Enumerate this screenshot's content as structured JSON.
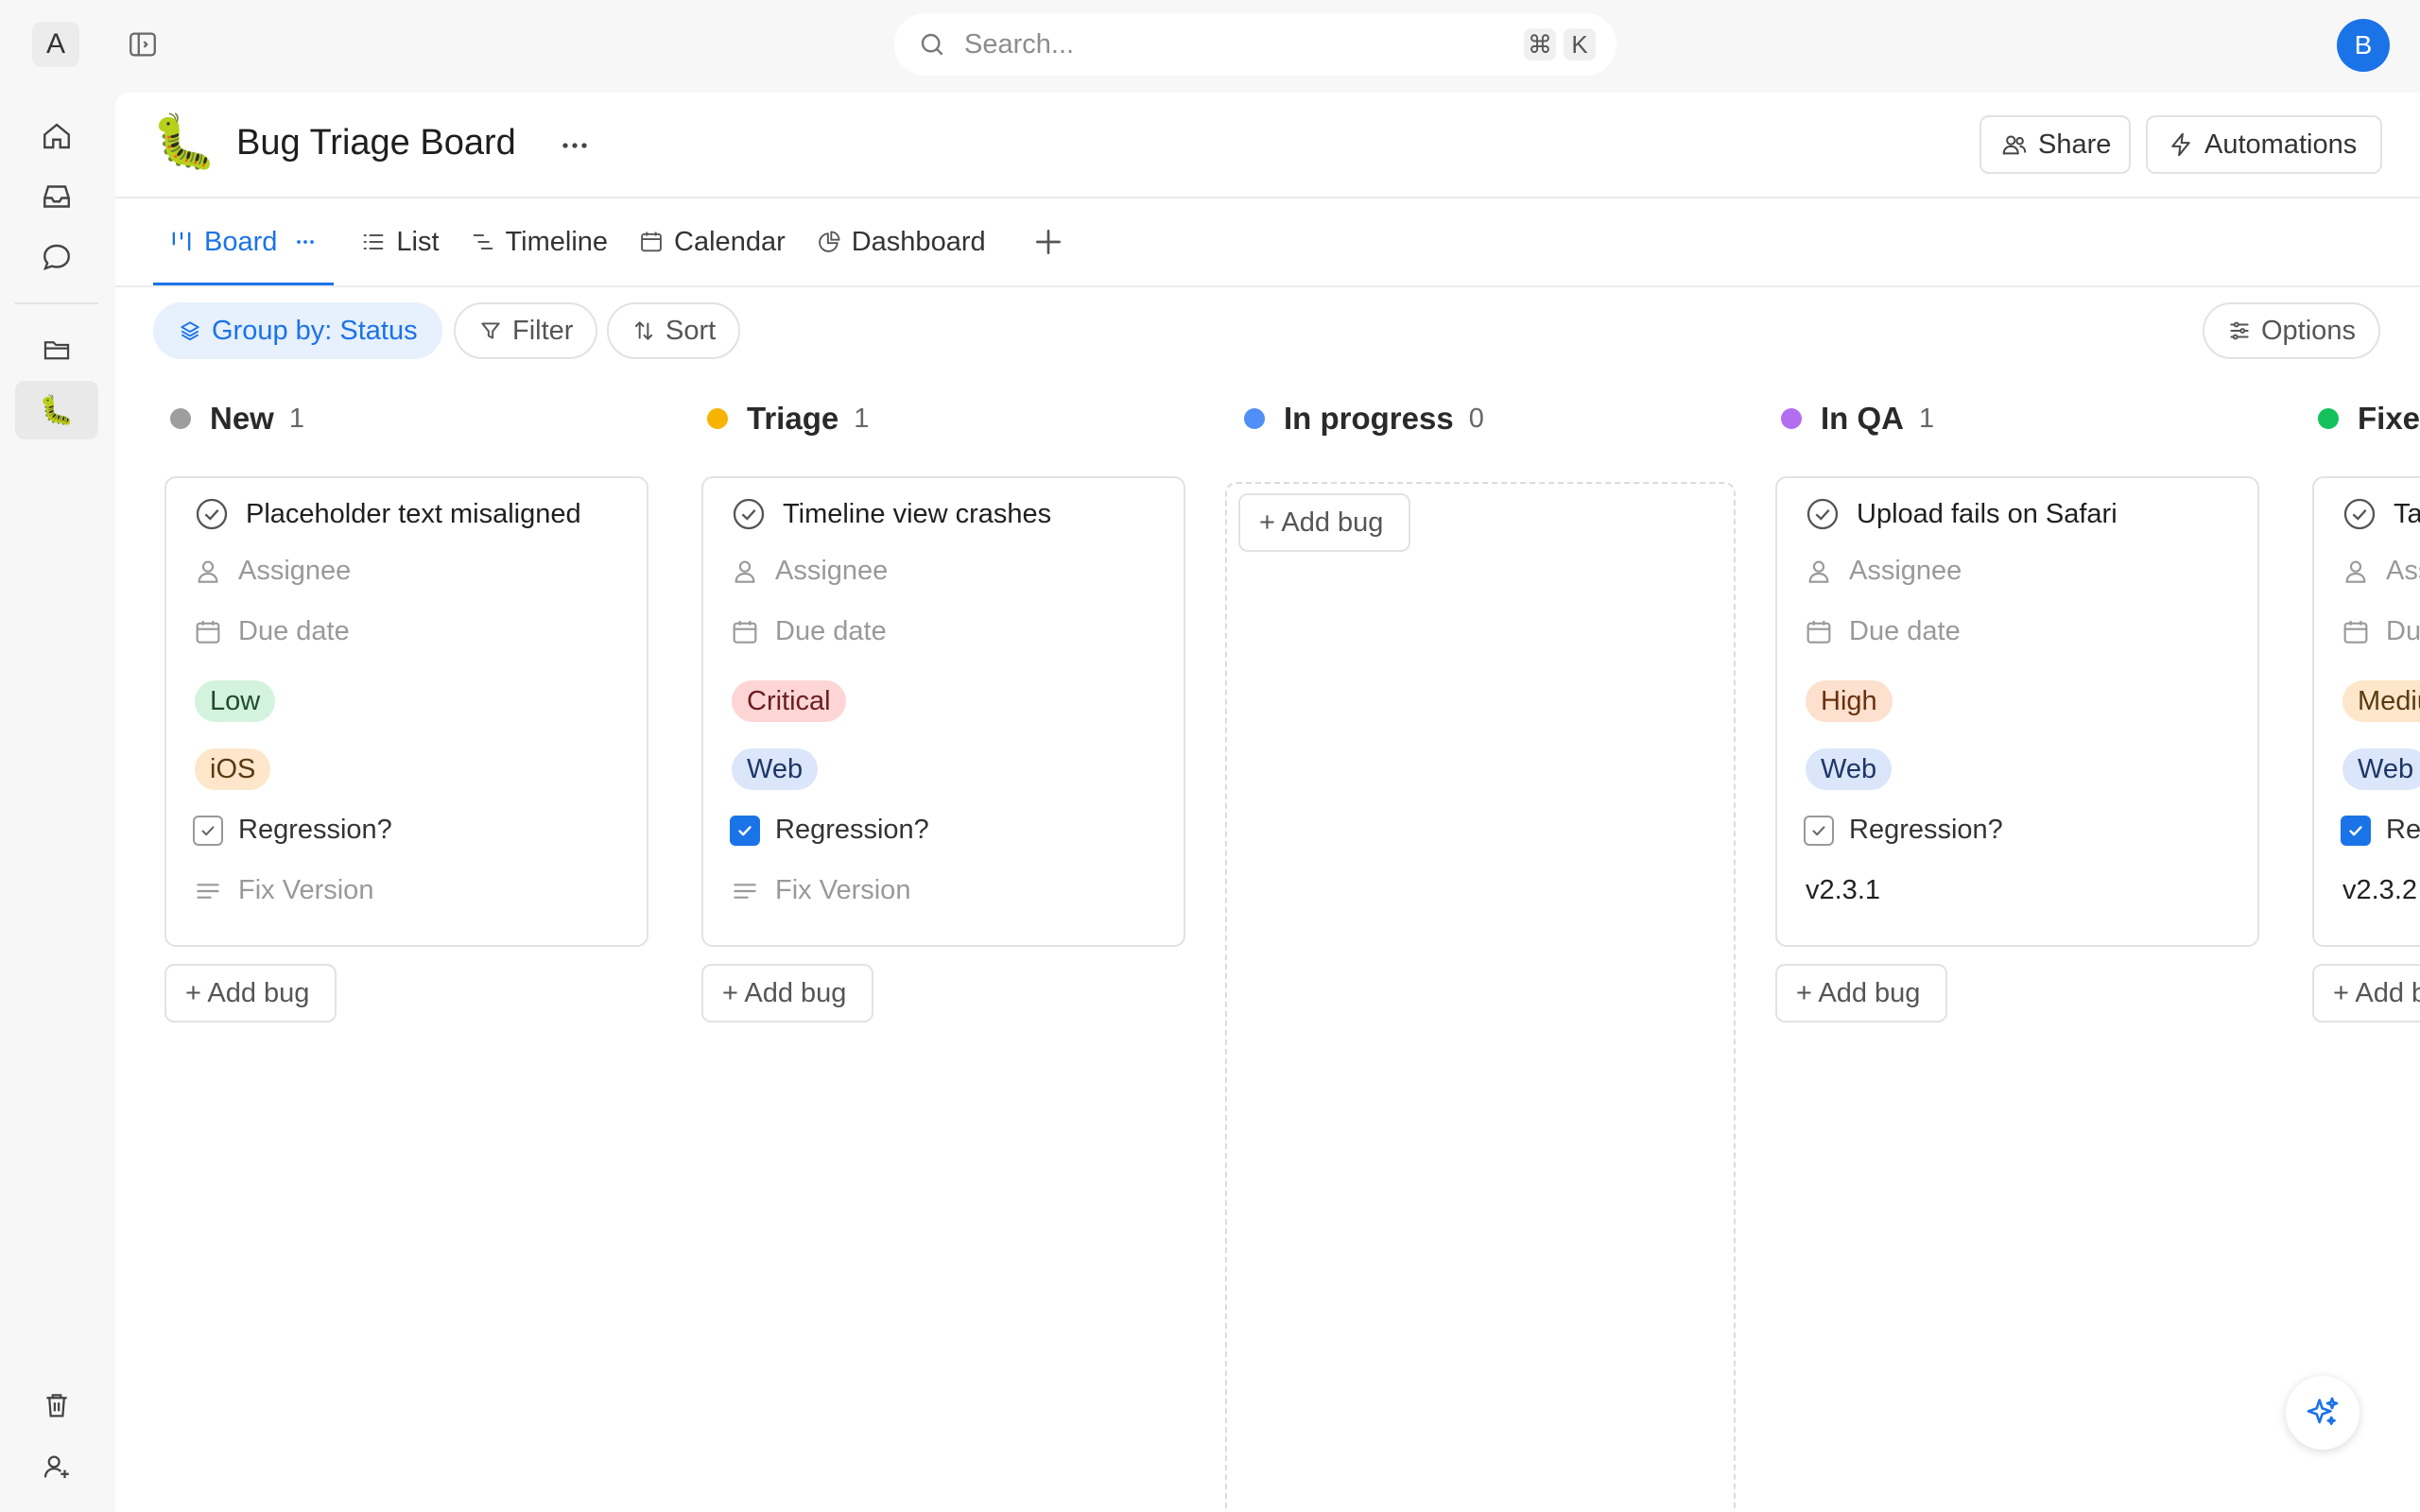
{
  "workspace": {
    "initial": "A"
  },
  "search": {
    "placeholder": "Search...",
    "shortcut_modifier": "⌘",
    "shortcut_key": "K"
  },
  "user": {
    "initial": "B"
  },
  "rail": {
    "top_icons": [
      "home-icon",
      "inbox-icon",
      "chat-icon"
    ],
    "mid_icons": [
      "folder-icon",
      "caterpillar-icon"
    ],
    "bottom_icons": [
      "trash-icon",
      "add-user-icon"
    ]
  },
  "board": {
    "emoji": "🐛",
    "title": "Bug Triage Board",
    "share_label": "Share",
    "automations_label": "Automations"
  },
  "tabs": [
    {
      "label": "Board",
      "icon": "board-icon",
      "active": true
    },
    {
      "label": "List",
      "icon": "list-icon"
    },
    {
      "label": "Timeline",
      "icon": "timeline-icon"
    },
    {
      "label": "Calendar",
      "icon": "calendar-icon"
    },
    {
      "label": "Dashboard",
      "icon": "dashboard-icon"
    }
  ],
  "toolbar": {
    "group_by": "Group by: Status",
    "filter": "Filter",
    "sort": "Sort",
    "options": "Options"
  },
  "colors": {
    "accent": "#1b73e8",
    "status_new": "#9e9e9e",
    "status_triage": "#f6b400",
    "status_in_progress": "#4f8ff7",
    "status_in_qa": "#b36ef0",
    "status_fixed": "#13c25b",
    "priority_low_bg": "#d4f3de",
    "priority_critical_bg": "#fdd5d5",
    "priority_high_bg": "#fde0cd",
    "priority_medium_bg": "#fde6c9",
    "platform_ios_bg": "#fde6c9",
    "platform_web_bg": "#dbe6fb"
  },
  "columns": [
    {
      "name": "New",
      "count": "1",
      "add_label": "+ Add bug",
      "card": {
        "title": "Placeholder text misaligned",
        "assignee": "Assignee",
        "due": "Due date",
        "priority": "Low",
        "platform": "iOS",
        "regression_label": "Regression?",
        "regression_checked": false,
        "fix_version": "Fix Version",
        "fix_version_set": false
      }
    },
    {
      "name": "Triage",
      "count": "1",
      "add_label": "+ Add bug",
      "card": {
        "title": "Timeline view crashes",
        "assignee": "Assignee",
        "due": "Due date",
        "priority": "Critical",
        "platform": "Web",
        "regression_label": "Regression?",
        "regression_checked": true,
        "fix_version": "Fix Version",
        "fix_version_set": false
      }
    },
    {
      "name": "In progress",
      "count": "0",
      "add_label": "+ Add bug"
    },
    {
      "name": "In QA",
      "count": "1",
      "add_label": "+ Add bug",
      "card": {
        "title": "Upload fails on Safari",
        "assignee": "Assignee",
        "due": "Due date",
        "priority": "High",
        "platform": "Web",
        "regression_label": "Regression?",
        "regression_checked": false,
        "fix_version": "v2.3.1",
        "fix_version_set": true
      }
    },
    {
      "name": "Fixed",
      "add_label": "+ Add bug",
      "card": {
        "title": "Ta",
        "assignee": "Assignee",
        "due": "Due date",
        "priority": "Medium",
        "platform": "Web",
        "regression_label": "Regression?",
        "regression_checked": true,
        "fix_version": "v2.3.2",
        "fix_version_set": true
      }
    }
  ]
}
